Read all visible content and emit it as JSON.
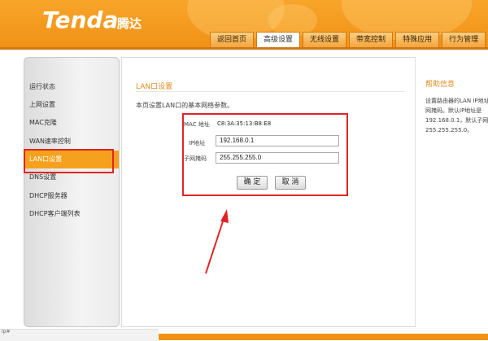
{
  "brand": {
    "logo": "Tenda",
    "name_cn": "腾达"
  },
  "nav": {
    "tabs": [
      {
        "label": "返回首页",
        "active": false
      },
      {
        "label": "高级设置",
        "active": true
      },
      {
        "label": "无线设置",
        "active": false
      },
      {
        "label": "带宽控制",
        "active": false
      },
      {
        "label": "特殊应用",
        "active": false
      },
      {
        "label": "行为管理",
        "active": false
      },
      {
        "label": "系",
        "active": false
      }
    ]
  },
  "sidebar": {
    "items": [
      {
        "label": "运行状态",
        "active": false
      },
      {
        "label": "上网设置",
        "active": false
      },
      {
        "label": "MAC克隆",
        "active": false
      },
      {
        "label": "WAN速率控制",
        "active": false
      },
      {
        "label": "LAN口设置",
        "active": true
      },
      {
        "label": "DNS设置",
        "active": false
      },
      {
        "label": "DHCP服务器",
        "active": false
      },
      {
        "label": "DHCP客户端列表",
        "active": false
      }
    ]
  },
  "main": {
    "title": "LAN口设置",
    "description": "本页设置LAN口的基本网络参数。",
    "mac_label": "MAC 地址",
    "mac_value": "C8:3A:35:13:B8:E8",
    "ip_label": "IP地址",
    "ip_value": "192.168.0.1",
    "mask_label": "子网掩码",
    "mask_value": "255.255.255.0",
    "ok_button": "确 定",
    "cancel_button": "取 消"
  },
  "help": {
    "title": "帮助信息",
    "text": "设置路由器的LAN IP地址\n网掩码。默认IP地址是\n192.168.0.1，默认子网\n255.255.255.0。"
  },
  "status": {
    "text": "ip#"
  },
  "colors": {
    "accent": "#f19216",
    "highlight": "#e02424"
  }
}
